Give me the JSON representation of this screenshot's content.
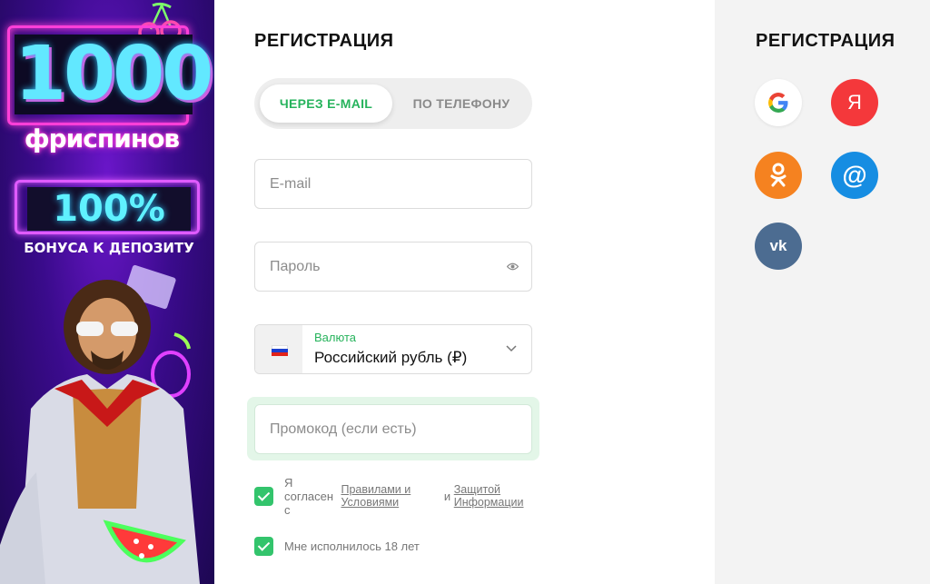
{
  "banner": {
    "big_number": "1000",
    "freespins": "фриспинов",
    "percent": "100%",
    "bonus": "БОНУСА К ДЕПОЗИТУ"
  },
  "form": {
    "title": "РЕГИСТРАЦИЯ",
    "tabs": [
      {
        "label": "ЧЕРЕЗ E-MAIL",
        "active": true
      },
      {
        "label": "ПО ТЕЛЕФОНУ",
        "active": false
      }
    ],
    "email": {
      "placeholder": "E-mail",
      "value": ""
    },
    "password": {
      "placeholder": "Пароль",
      "value": ""
    },
    "currency": {
      "label": "Валюта",
      "value": "Российский рубль (₽)"
    },
    "promo": {
      "placeholder": "Промокод (если есть)",
      "value": ""
    },
    "agree": {
      "text_before": "Я согласен с",
      "rules_link": "Правилами и Условиями",
      "and": "и",
      "privacy_link": "Защитой Информации",
      "checked": true
    },
    "age": {
      "text": "Мне исполнилось 18 лет",
      "checked": true
    }
  },
  "social": {
    "title": "РЕГИСТРАЦИЯ",
    "yandex_label": "Я",
    "mail_label": "@",
    "vk_label": "vk"
  },
  "colors": {
    "accent_green": "#26b35c",
    "checkbox_green": "#33c46c",
    "yandex_red": "#f4383b",
    "ok_orange": "#f58220",
    "mail_blue": "#168de2",
    "vk_blue": "#4c6c91"
  }
}
